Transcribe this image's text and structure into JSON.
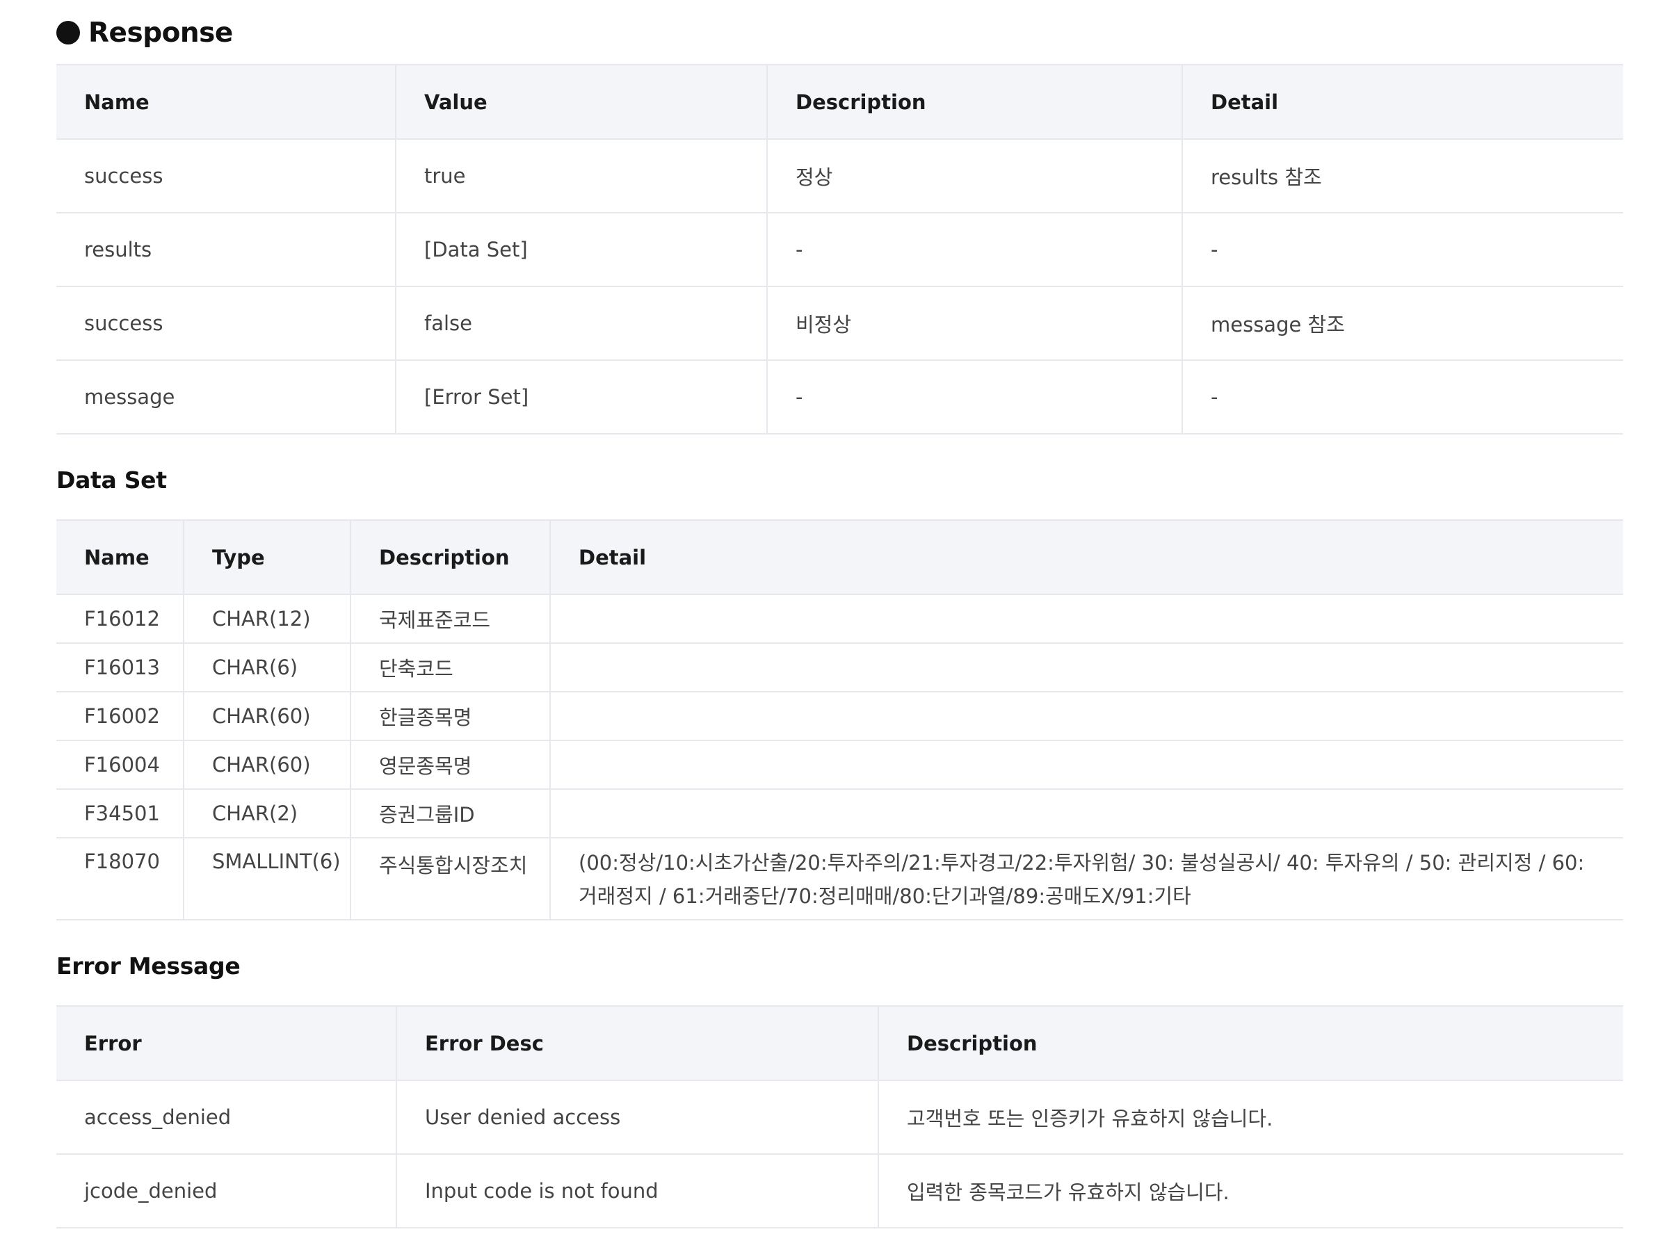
{
  "response": {
    "title": "Response",
    "headers": [
      "Name",
      "Value",
      "Description",
      "Detail"
    ],
    "rows": [
      [
        "success",
        "true",
        "정상",
        "results 참조"
      ],
      [
        "results",
        "[Data Set]",
        "-",
        "-"
      ],
      [
        "success",
        "false",
        "비정상",
        "message 참조"
      ],
      [
        "message",
        "[Error Set]",
        "-",
        "-"
      ]
    ]
  },
  "data_set": {
    "title": "Data Set",
    "headers": [
      "Name",
      "Type",
      "Description",
      "Detail"
    ],
    "rows": [
      [
        "F16012",
        "CHAR(12)",
        "국제표준코드",
        ""
      ],
      [
        "F16013",
        "CHAR(6)",
        "단축코드",
        ""
      ],
      [
        "F16002",
        "CHAR(60)",
        "한글종목명",
        ""
      ],
      [
        "F16004",
        "CHAR(60)",
        "영문종목명",
        ""
      ],
      [
        "F34501",
        "CHAR(2)",
        "증권그룹ID",
        ""
      ],
      [
        "F18070",
        "SMALLINT(6)",
        "주식통합시장조치",
        "(00:정상/10:시초가산출/20:투자주의/21:투자경고/22:투자위험/ 30: 불성실공시/ 40: 투자유의 / 50: 관리지정 / 60: 거래정지 / 61:거래중단/70:정리매매/80:단기과열/89:공매도X/91:기타"
      ]
    ]
  },
  "error_message": {
    "title": "Error Message",
    "headers": [
      "Error",
      "Error Desc",
      "Description"
    ],
    "rows": [
      [
        "access_denied",
        "User denied access",
        "고객번호 또는 인증키가 유효하지 않습니다."
      ],
      [
        "jcode_denied",
        "Input code is not found",
        "입력한 종목코드가 유효하지 않습니다."
      ]
    ]
  }
}
